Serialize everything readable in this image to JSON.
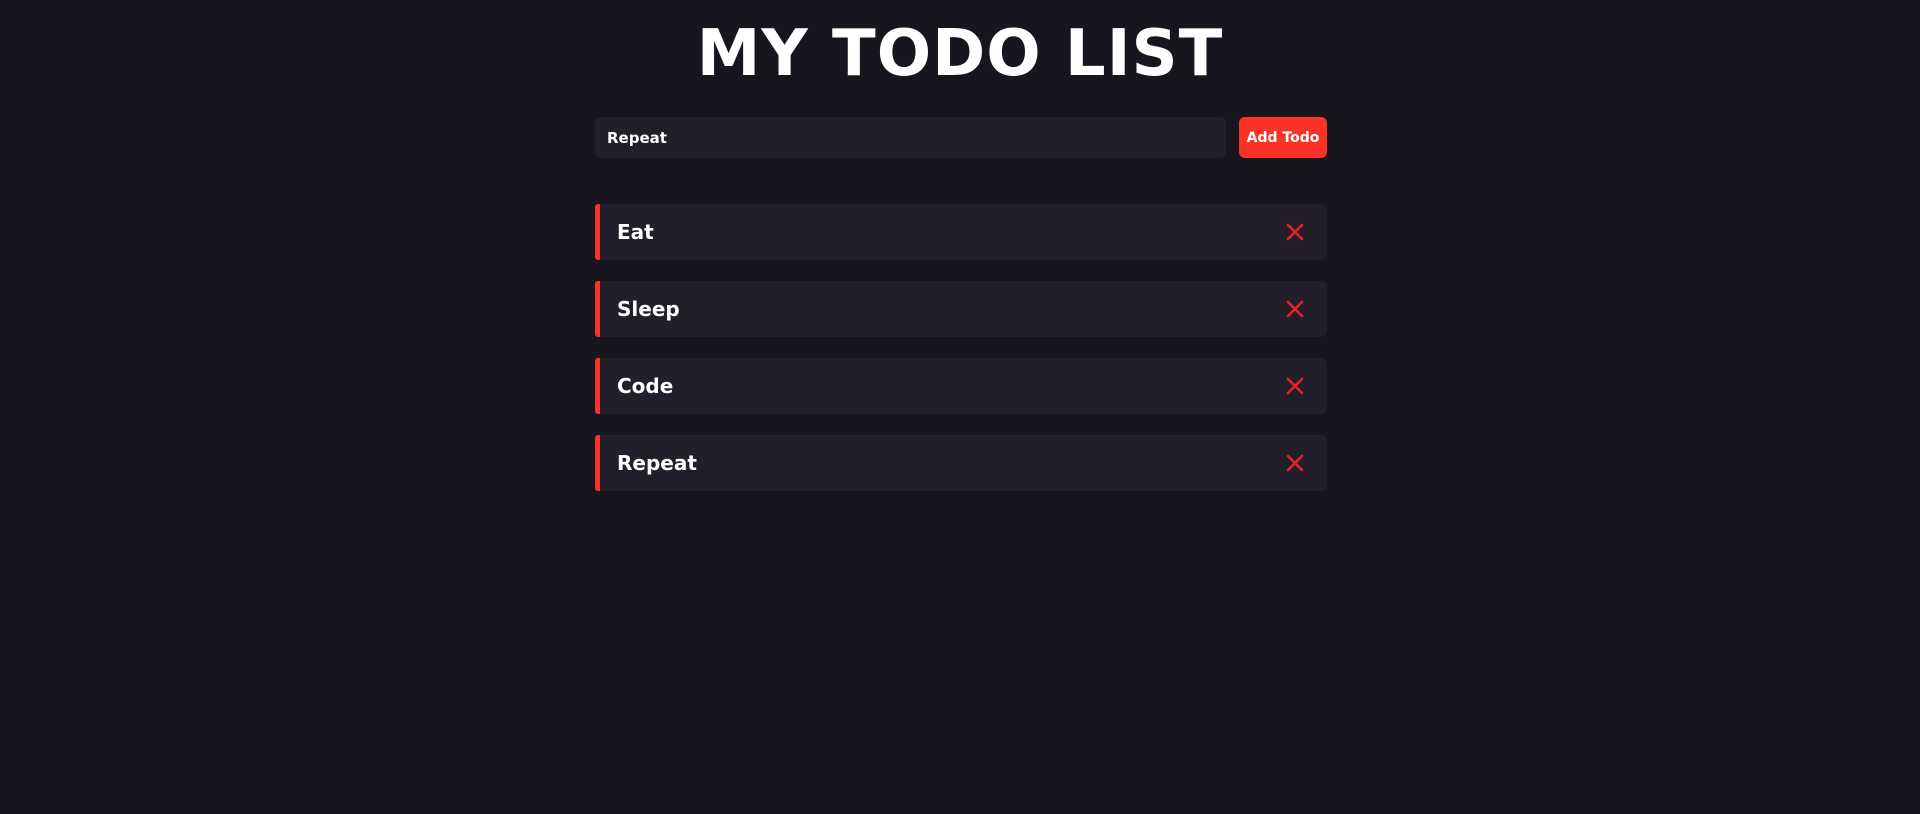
{
  "app": {
    "title": "MY TODO LIST"
  },
  "form": {
    "input_value": "Repeat",
    "add_button_label": "Add Todo"
  },
  "todos": [
    {
      "text": "Eat"
    },
    {
      "text": "Sleep"
    },
    {
      "text": "Code"
    },
    {
      "text": "Repeat"
    }
  ],
  "icons": {
    "delete": "close-icon"
  },
  "colors": {
    "background": "#18151f",
    "surface": "#221e2a",
    "accent": "#fb3226",
    "delete_icon": "#e8202a",
    "text": "#ffffff"
  }
}
